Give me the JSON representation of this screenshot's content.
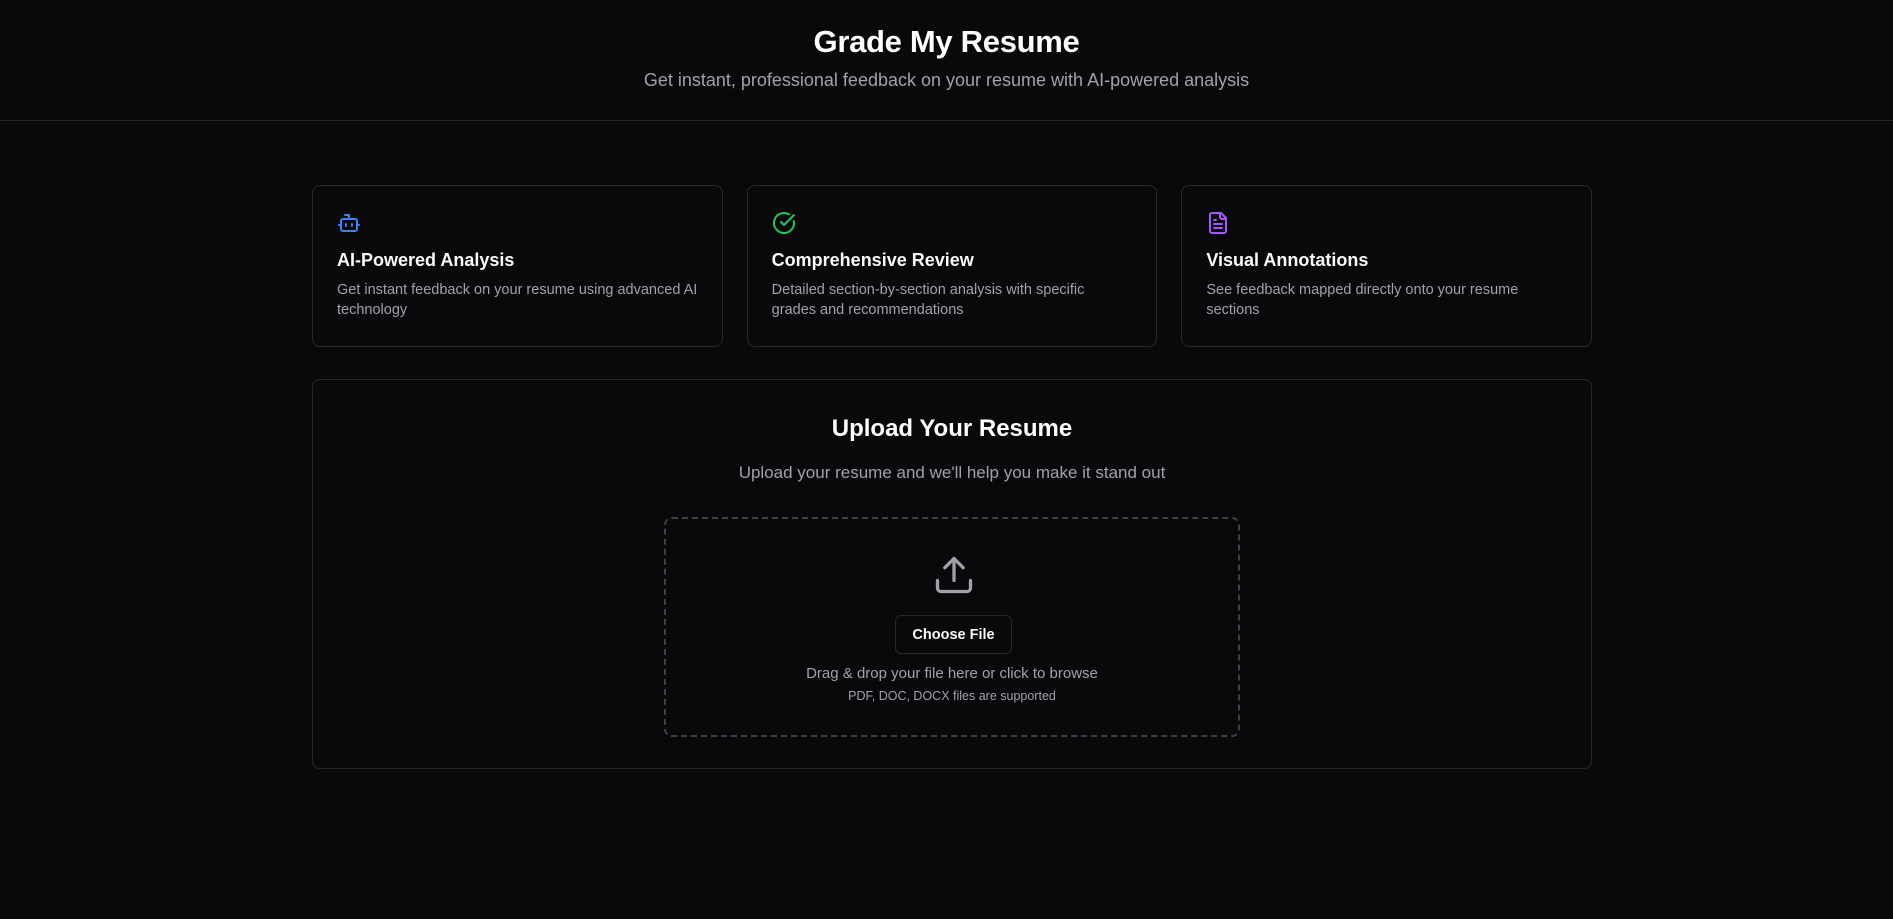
{
  "header": {
    "title": "Grade My Resume",
    "subtitle": "Get instant, professional feedback on your resume with AI-powered analysis"
  },
  "features": [
    {
      "icon": "bot-icon",
      "icon_color": "#3b82f6",
      "title": "AI-Powered Analysis",
      "description": "Get instant feedback on your resume using advanced AI technology"
    },
    {
      "icon": "circle-check-icon",
      "icon_color": "#22c55e",
      "title": "Comprehensive Review",
      "description": "Detailed section-by-section analysis with specific grades and recommendations"
    },
    {
      "icon": "file-text-icon",
      "icon_color": "#a855f7",
      "title": "Visual Annotations",
      "description": "See feedback mapped directly onto your resume sections"
    }
  ],
  "upload": {
    "title": "Upload Your Resume",
    "subtitle": "Upload your resume and we'll help you make it stand out",
    "icon": "upload-icon",
    "button_label": "Choose File",
    "drop_text": "Drag & drop your file here or click to browse",
    "supported_text": "PDF, DOC, DOCX files are supported"
  }
}
